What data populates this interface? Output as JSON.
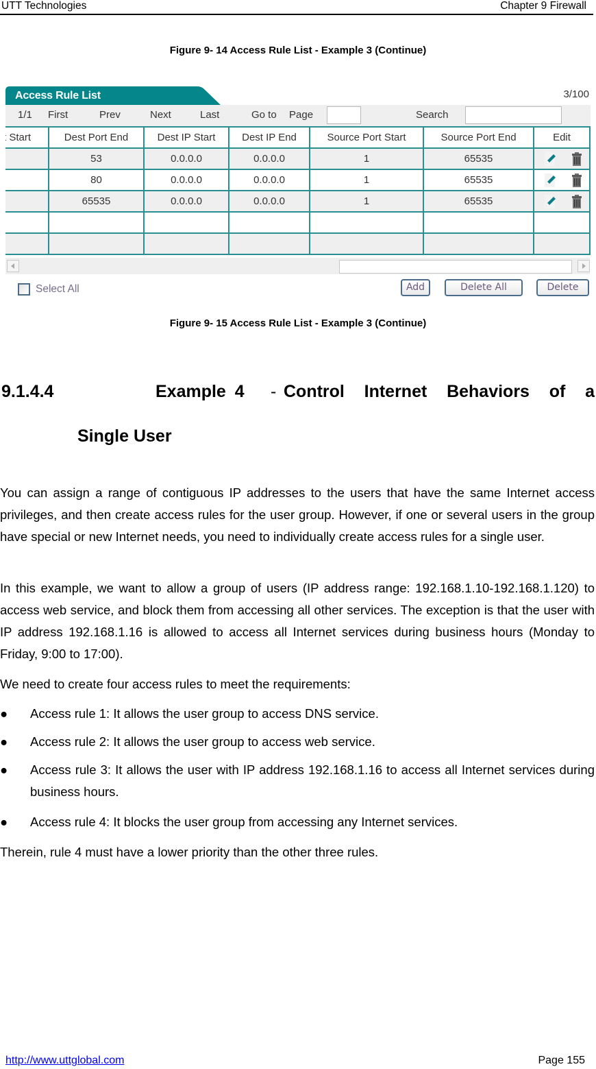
{
  "header": {
    "left": "UTT Technologies",
    "right": "Chapter 9 Firewall"
  },
  "figure_top_caption": "Figure 9- 14 Access Rule List - Example 3 (Continue)",
  "widget": {
    "title": "Access Rule List",
    "count": "3/100",
    "toolbar": {
      "page_info": "1/1",
      "first": "First",
      "prev": "Prev",
      "next": "Next",
      "last": "Last",
      "goto": "Go to",
      "page": "Page",
      "page_input_value": "",
      "search": "Search",
      "search_input_value": ""
    },
    "columns": [
      "rt Start",
      "Dest Port End",
      "Dest IP Start",
      "Dest IP End",
      "Source Port Start",
      "Source Port End",
      "Edit"
    ],
    "rows": [
      {
        "dest_port_end": "53",
        "dest_ip_start": "0.0.0.0",
        "dest_ip_end": "0.0.0.0",
        "source_port_start": "1",
        "source_port_end": "65535"
      },
      {
        "dest_port_end": "80",
        "dest_ip_start": "0.0.0.0",
        "dest_ip_end": "0.0.0.0",
        "source_port_start": "1",
        "source_port_end": "65535"
      },
      {
        "dest_port_end": "65535",
        "dest_ip_start": "0.0.0.0",
        "dest_ip_end": "0.0.0.0",
        "source_port_start": "1",
        "source_port_end": "65535"
      }
    ],
    "select_all": "Select All",
    "buttons": {
      "add": "Add",
      "delete_all": "Delete All",
      "delete": "Delete"
    },
    "colors": {
      "accent": "#05868a",
      "grid_border": "#2a8f92",
      "row_alt": "#efefef"
    }
  },
  "figure_bottom_caption": "Figure 9- 15 Access Rule List - Example 3 (Continue)",
  "section": {
    "number": "9.1.4.4",
    "title_part1": "Example 4",
    "dash": "-",
    "title_part2": "Control Internet Behaviors of a",
    "title_line2": "Single User"
  },
  "body": {
    "para1": "You can assign a range of contiguous IP addresses to the users that have the same Internet access privileges, and then create access rules for the user group. However, if one or several users in the group have special or new Internet needs, you need to individually create access rules for a single user.",
    "para2": "In this example, we want to allow a group of users (IP address range: 192.168.1.10-192.168.1.120) to access web service, and block them from accessing all other services. The exception is that the user with IP address 192.168.1.16 is allowed to access all Internet services during business hours (Monday to Friday, 9:00 to 17:00).",
    "para3": "We need to create four access rules to meet the requirements:",
    "bullets": [
      "Access rule 1: It allows the user group to access DNS service.",
      "Access rule 2: It allows the user group to access web service.",
      "Access rule 3: It allows the user with IP address 192.168.1.16 to access all Internet services during business hours.",
      "Access rule 4: It blocks the user group from accessing any Internet services."
    ],
    "bullet_glyph": "●",
    "para4": "Therein, rule 4 must have a lower priority than the other three rules."
  },
  "footer": {
    "link": "http://www.uttglobal.com",
    "page": "Page 155"
  }
}
